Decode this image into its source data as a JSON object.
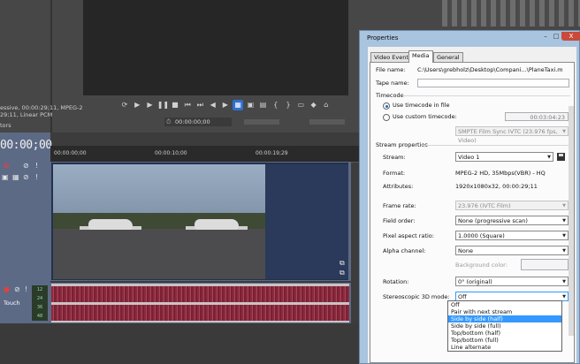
{
  "background_app": {
    "media_info": [
      "essive, 00:00:29;11, MPEG-2",
      "29;11, Linear PCM",
      "tors"
    ],
    "cursor_timecode": "00:00:00;00",
    "main_timecode": "00:00;00",
    "ruler_labels": [
      "00:00:00;00",
      "00:00:10;00",
      "00:00:19;29"
    ],
    "track_touch_label": "Touch",
    "db_labels": [
      "12",
      "24",
      "36",
      "48"
    ]
  },
  "dialog": {
    "title": "Properties",
    "tabs": [
      "Video Event",
      "Media",
      "General"
    ],
    "active_tab": "Media",
    "file_name_label": "File name:",
    "file_name_value": "C:\\Users\\grebholz\\Desktop\\Compani...\\PlaneTaxi.m",
    "tape_name_label": "Tape name:",
    "tape_name_value": "",
    "timecode_header": "Timecode",
    "use_timecode_label": "Use timecode in file",
    "use_custom_label": "Use custom timecode:",
    "custom_timecode_value": "00:03:04:23",
    "timecode_format": "SMPTE Film Sync IVTC (23.976 fps, Video)",
    "stream_properties_header": "Stream properties",
    "stream_label": "Stream:",
    "stream_value": "Video 1",
    "format_label": "Format:",
    "format_value": "MPEG-2 HD, 35Mbps(VBR) - HQ",
    "attributes_label": "Attributes:",
    "attributes_value": "1920x1080x32, 00:00:29;11",
    "frame_rate_label": "Frame rate:",
    "frame_rate_value": "23.976 (IVTC Film)",
    "field_order_label": "Field order:",
    "field_order_value": "None (progressive scan)",
    "pixel_aspect_label": "Pixel aspect ratio:",
    "pixel_aspect_value": "1.0000 (Square)",
    "alpha_label": "Alpha channel:",
    "alpha_value": "None",
    "background_color_label": "Background color:",
    "rotation_label": "Rotation:",
    "rotation_value": "0° (original)",
    "stereo_label": "Stereoscopic 3D mode:",
    "stereo_value": "Off",
    "stereo_options": [
      "Off",
      "Pair with next stream",
      "Side by side (half)",
      "Side by side (full)",
      "Top/bottom (half)",
      "Top/bottom (full)",
      "Line alternate"
    ],
    "highlighted_option": "Side by side (half)",
    "window_buttons": {
      "minimize": "–",
      "maximize": "□",
      "close": "X"
    }
  },
  "colors": {
    "dialog_frame": "#a9c4de",
    "highlight": "#3399ff",
    "timeline_track": "#5d6a86",
    "audio_wave": "#8a2a3e"
  }
}
